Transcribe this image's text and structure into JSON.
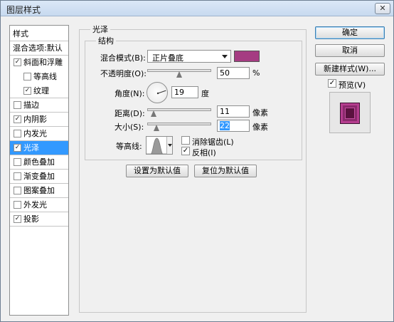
{
  "window": {
    "title": "图层样式",
    "close_glyph": "✕"
  },
  "left_panel": {
    "header": "样式",
    "blend_options": "混合选项:默认",
    "items": [
      {
        "label": "斜面和浮雕",
        "checked": true
      },
      {
        "label": "等高线",
        "checked": false
      },
      {
        "label": "纹理",
        "checked": true
      },
      {
        "label": "描边",
        "checked": false
      },
      {
        "label": "内阴影",
        "checked": true
      },
      {
        "label": "内发光",
        "checked": false
      },
      {
        "label": "光泽",
        "checked": true,
        "selected": true
      },
      {
        "label": "颜色叠加",
        "checked": false
      },
      {
        "label": "渐变叠加",
        "checked": false
      },
      {
        "label": "图案叠加",
        "checked": false
      },
      {
        "label": "外发光",
        "checked": false
      },
      {
        "label": "投影",
        "checked": true
      }
    ]
  },
  "satin": {
    "group_title": "光泽",
    "structure_title": "结构",
    "blend_mode": {
      "label": "混合模式(B):",
      "value": "正片叠底",
      "color": "#a53c82"
    },
    "opacity": {
      "label": "不透明度(O):",
      "value": "50",
      "unit": "%",
      "fraction": 0.5
    },
    "angle": {
      "label": "角度(N):",
      "value": "19",
      "unit": "度",
      "degrees": 19
    },
    "distance": {
      "label": "距离(D):",
      "value": "11",
      "unit": "像素"
    },
    "size": {
      "label": "大小(S):",
      "value": "22",
      "unit": "像素"
    },
    "contour": {
      "label": "等高线:"
    },
    "anti_alias": {
      "label": "消除锯齿(L)",
      "checked": false
    },
    "invert": {
      "label": "反相(I)",
      "checked": true
    },
    "set_default": "设置为默认值",
    "reset_default": "复位为默认值"
  },
  "right": {
    "ok": "确定",
    "cancel": "取消",
    "new_style": "新建样式(W)...",
    "preview": {
      "label": "预览(V)",
      "checked": true
    }
  },
  "check_glyph": "✓"
}
